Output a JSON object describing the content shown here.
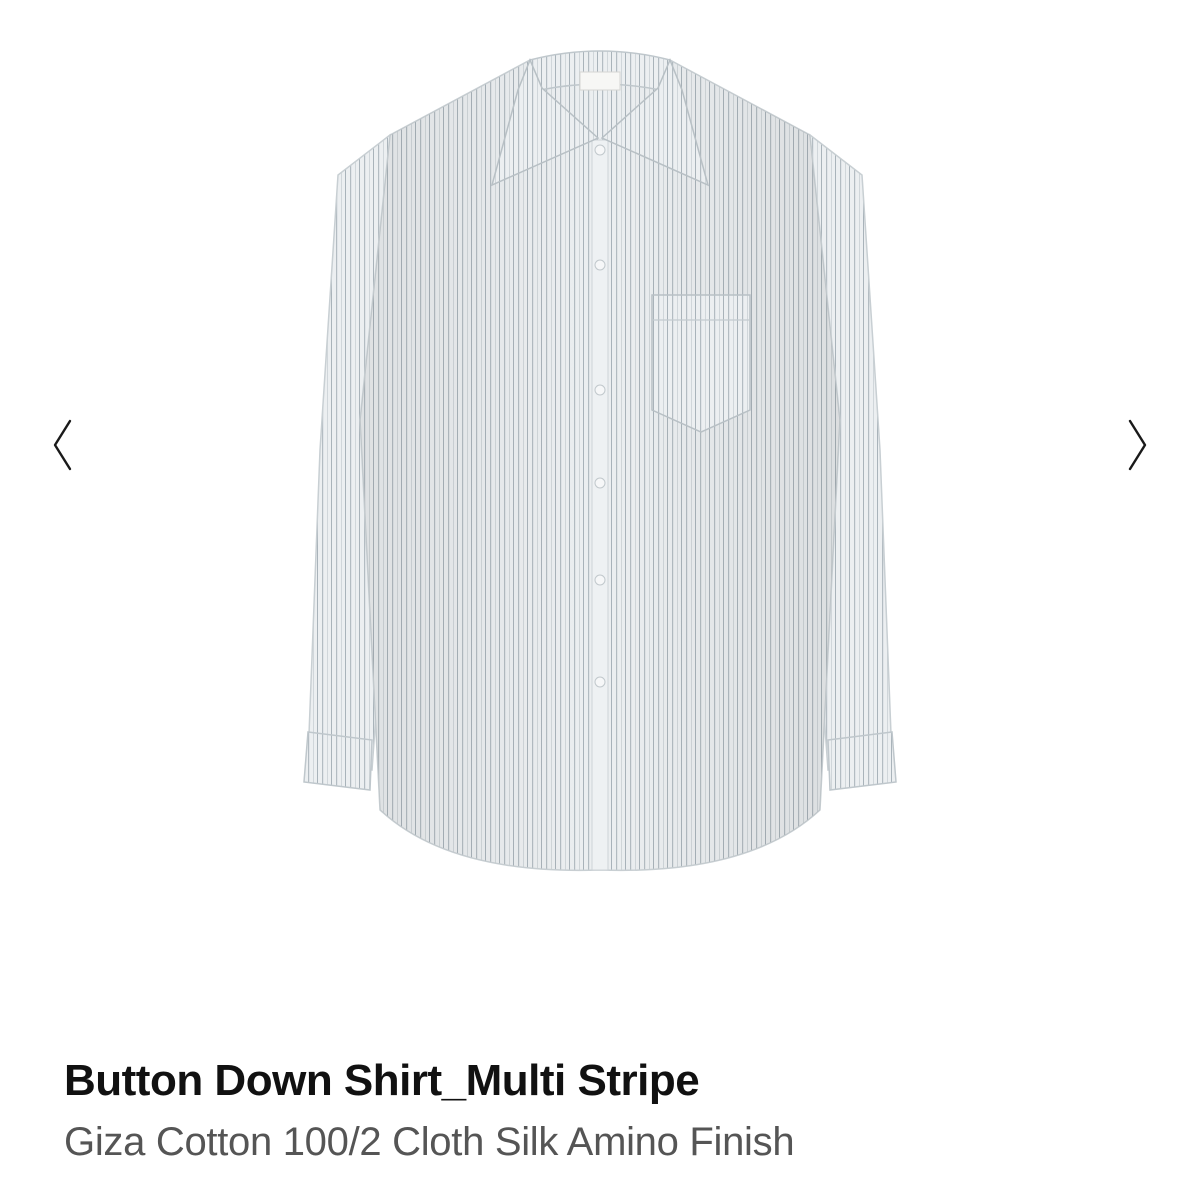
{
  "gallery": {
    "prev_icon": "chevron-left-icon",
    "next_icon": "chevron-right-icon"
  },
  "product": {
    "title": "Button Down Shirt_Multi Stripe",
    "subtitle": "Giza Cotton 100/2 Cloth Silk Amino Finish"
  },
  "colors": {
    "title": "#111111",
    "subtitle": "#555555",
    "shirt": "#e9ecee",
    "stripe": "#aeb7bd"
  }
}
